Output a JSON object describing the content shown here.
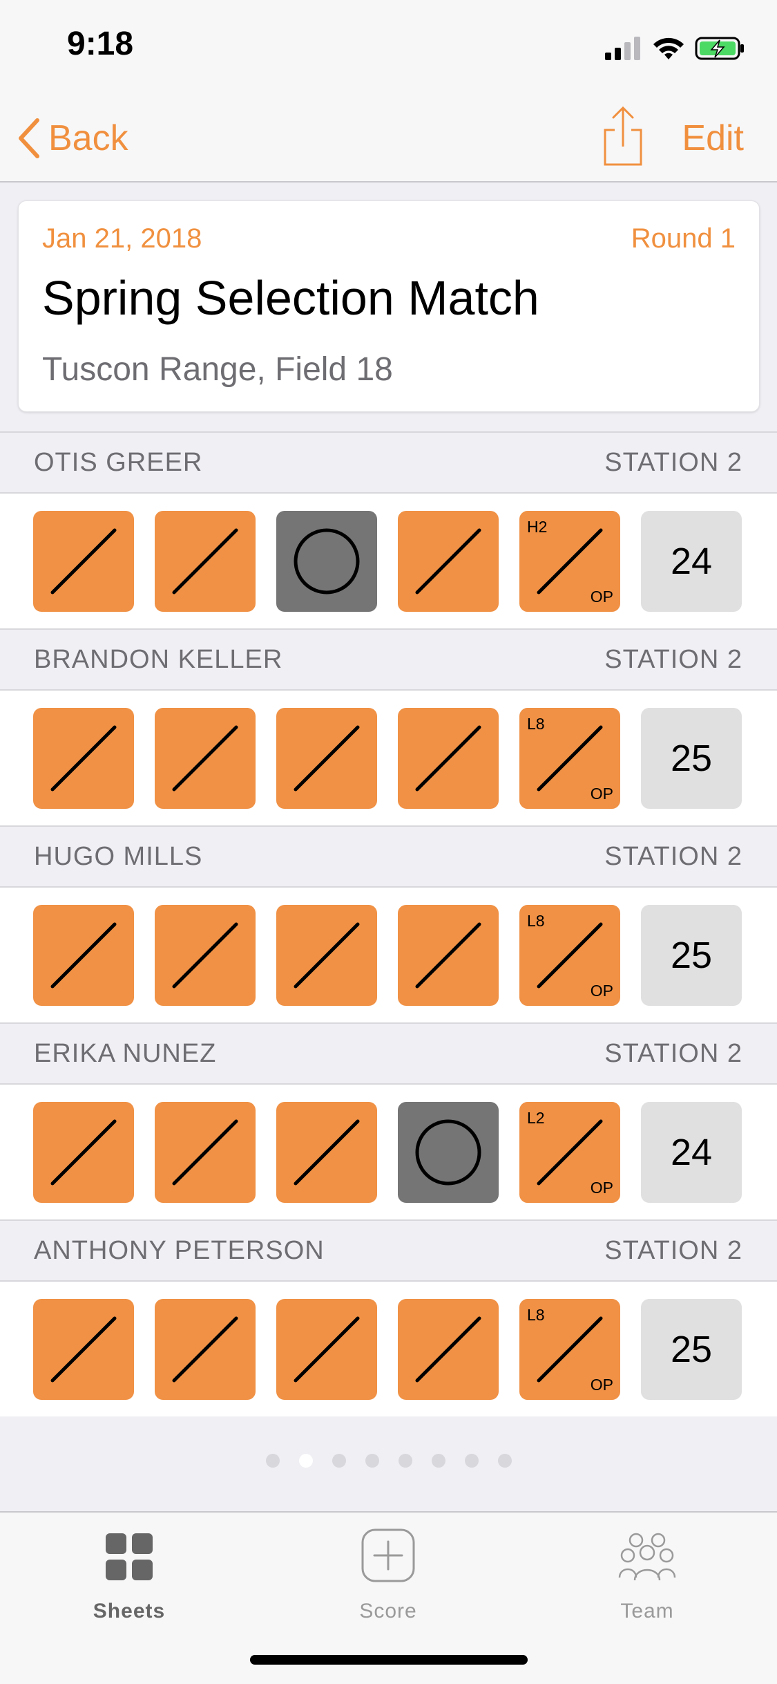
{
  "status_bar": {
    "time": "9:18"
  },
  "nav": {
    "back_label": "Back",
    "edit_label": "Edit"
  },
  "event": {
    "date": "Jan 21, 2018",
    "round": "Round 1",
    "title": "Spring Selection Match",
    "location": "Tuscon Range, Field 18"
  },
  "players": [
    {
      "name": "OTIS GREER",
      "station": "STATION 2",
      "score": "24",
      "shots": [
        "hit",
        "hit",
        "miss",
        "hit",
        "hit"
      ],
      "last_tag": "H2",
      "last_note": "OP"
    },
    {
      "name": "BRANDON KELLER",
      "station": "STATION 2",
      "score": "25",
      "shots": [
        "hit",
        "hit",
        "hit",
        "hit",
        "hit"
      ],
      "last_tag": "L8",
      "last_note": "OP"
    },
    {
      "name": "HUGO MILLS",
      "station": "STATION 2",
      "score": "25",
      "shots": [
        "hit",
        "hit",
        "hit",
        "hit",
        "hit"
      ],
      "last_tag": "L8",
      "last_note": "OP"
    },
    {
      "name": "ERIKA NUNEZ",
      "station": "STATION 2",
      "score": "24",
      "shots": [
        "hit",
        "hit",
        "hit",
        "miss",
        "hit"
      ],
      "last_tag": "L2",
      "last_note": "OP"
    },
    {
      "name": "ANTHONY PETERSON",
      "station": "STATION 2",
      "score": "25",
      "shots": [
        "hit",
        "hit",
        "hit",
        "hit",
        "hit"
      ],
      "last_tag": "L8",
      "last_note": "OP"
    }
  ],
  "pager": {
    "count": 8,
    "active_index": 1
  },
  "tabs": [
    {
      "label": "Sheets",
      "icon": "grid-icon",
      "selected": true
    },
    {
      "label": "Score",
      "icon": "plus-square-icon",
      "selected": false
    },
    {
      "label": "Team",
      "icon": "team-icon",
      "selected": false
    }
  ],
  "colors": {
    "accent": "#f0903f",
    "hit": "#f09145",
    "miss": "#757575"
  }
}
